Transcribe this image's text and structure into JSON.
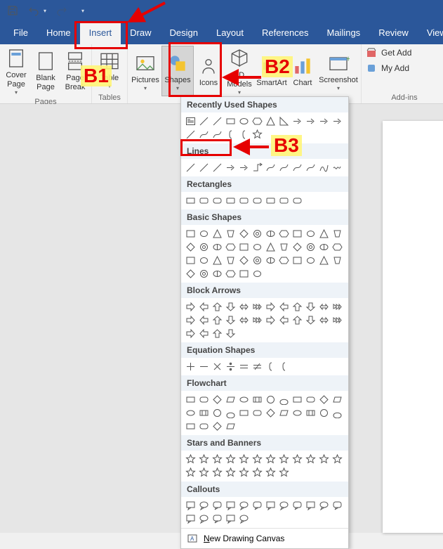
{
  "qat": {
    "save": "save",
    "undo": "undo",
    "redo": "redo"
  },
  "tabs": {
    "file": "File",
    "home": "Home",
    "insert": "Insert",
    "draw": "Draw",
    "design": "Design",
    "layout": "Layout",
    "references": "References",
    "mailings": "Mailings",
    "review": "Review",
    "view": "View"
  },
  "ribbon": {
    "pages": {
      "label": "Pages",
      "cover_page": "Cover\nPage",
      "blank_page": "Blank\nPage",
      "page_break": "Page\nBreak"
    },
    "tables": {
      "label": "Tables",
      "table": "Table"
    },
    "illustrations": {
      "pictures": "Pictures",
      "shapes": "Shapes",
      "icons": "Icons",
      "models": "3D\nModels",
      "smartart": "SmartArt",
      "chart": "Chart",
      "screenshot": "Screenshot"
    },
    "addins": {
      "label": "Add-ins",
      "get": "Get Add",
      "my": "My Add"
    }
  },
  "gallery": {
    "recent": "Recently Used Shapes",
    "lines": "Lines",
    "rectangles": "Rectangles",
    "basic": "Basic Shapes",
    "block_arrows": "Block Arrows",
    "equation": "Equation Shapes",
    "flowchart": "Flowchart",
    "stars": "Stars and Banners",
    "callouts": "Callouts",
    "footer": "New Drawing Canvas"
  },
  "shapes": {
    "recent_count": 18,
    "lines_count": 12,
    "rectangles_count": 9,
    "basic_count": 42,
    "block_count": 28,
    "equation_count": 8,
    "flowchart_count": 28,
    "stars_count": 20,
    "callouts_count": 17
  },
  "annotations": {
    "b1": "B1",
    "b2": "B2",
    "b3": "B3"
  },
  "colors": {
    "brand": "#2b579a",
    "anno_red": "#e60000",
    "anno_hl": "#fff578"
  }
}
